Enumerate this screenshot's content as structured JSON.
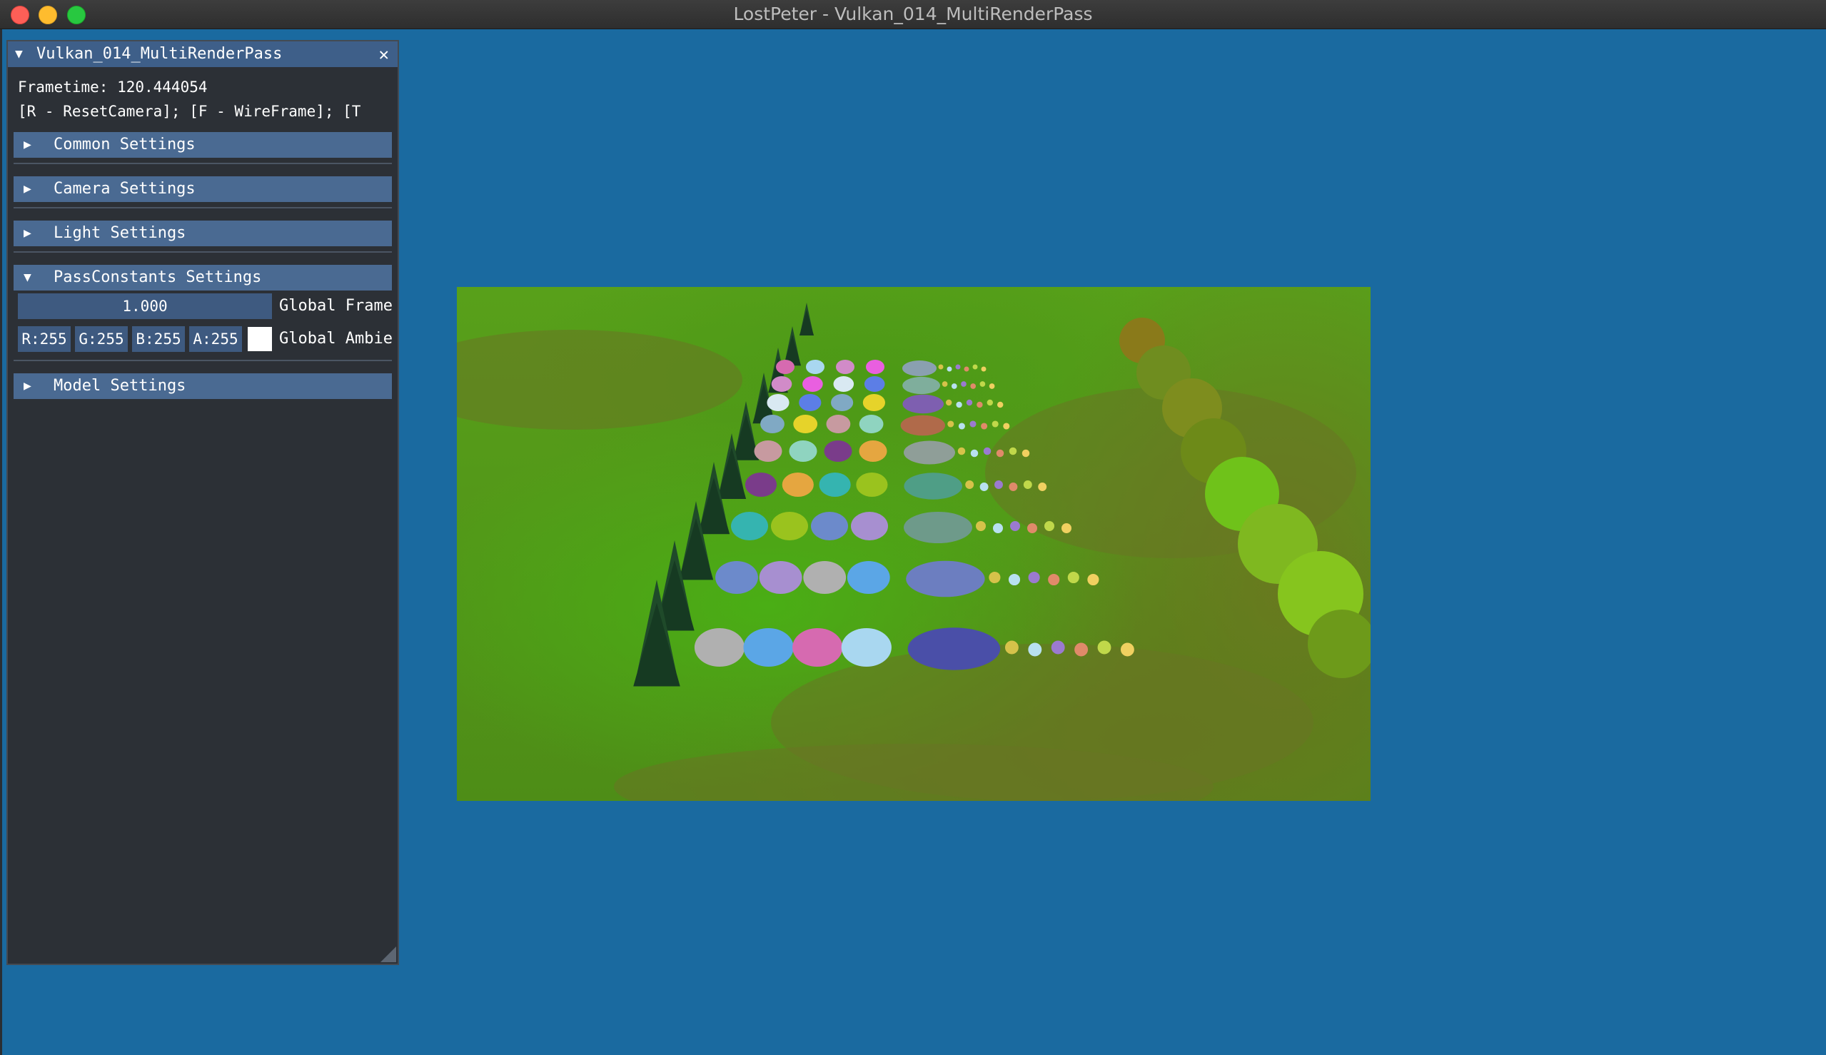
{
  "window": {
    "title": "LostPeter - Vulkan_014_MultiRenderPass"
  },
  "panel": {
    "title": "Vulkan_014_MultiRenderPass",
    "close_glyph": "✕",
    "frametime_label": "Frametime: 120.444054",
    "shortcuts_label": "[R - ResetCamera]; [F - WireFrame]; [T",
    "sections": {
      "common": "Common Settings",
      "camera": "Camera Settings",
      "light": "Light Settings",
      "pass_constants": "PassConstants Settings",
      "model": "Model Settings"
    },
    "pass_constants": {
      "frame_value": "1.000",
      "frame_label": "Global Frame",
      "ambient": {
        "r": "R:255",
        "g": "G:255",
        "b": "B:255",
        "a": "A:255",
        "label": "Global Ambie",
        "swatch_color": "#ffffff"
      }
    }
  },
  "icons": {
    "collapse": "triangle-down-icon",
    "expand": "triangle-right-icon",
    "close": "close-icon",
    "resize": "resize-grip-icon"
  },
  "colors": {
    "desktop": "#1a6aa0",
    "panel_bg": "#2c3036",
    "title_active": "#3e5f89",
    "header": "#4a6a92",
    "frame": "#3e5a80"
  }
}
